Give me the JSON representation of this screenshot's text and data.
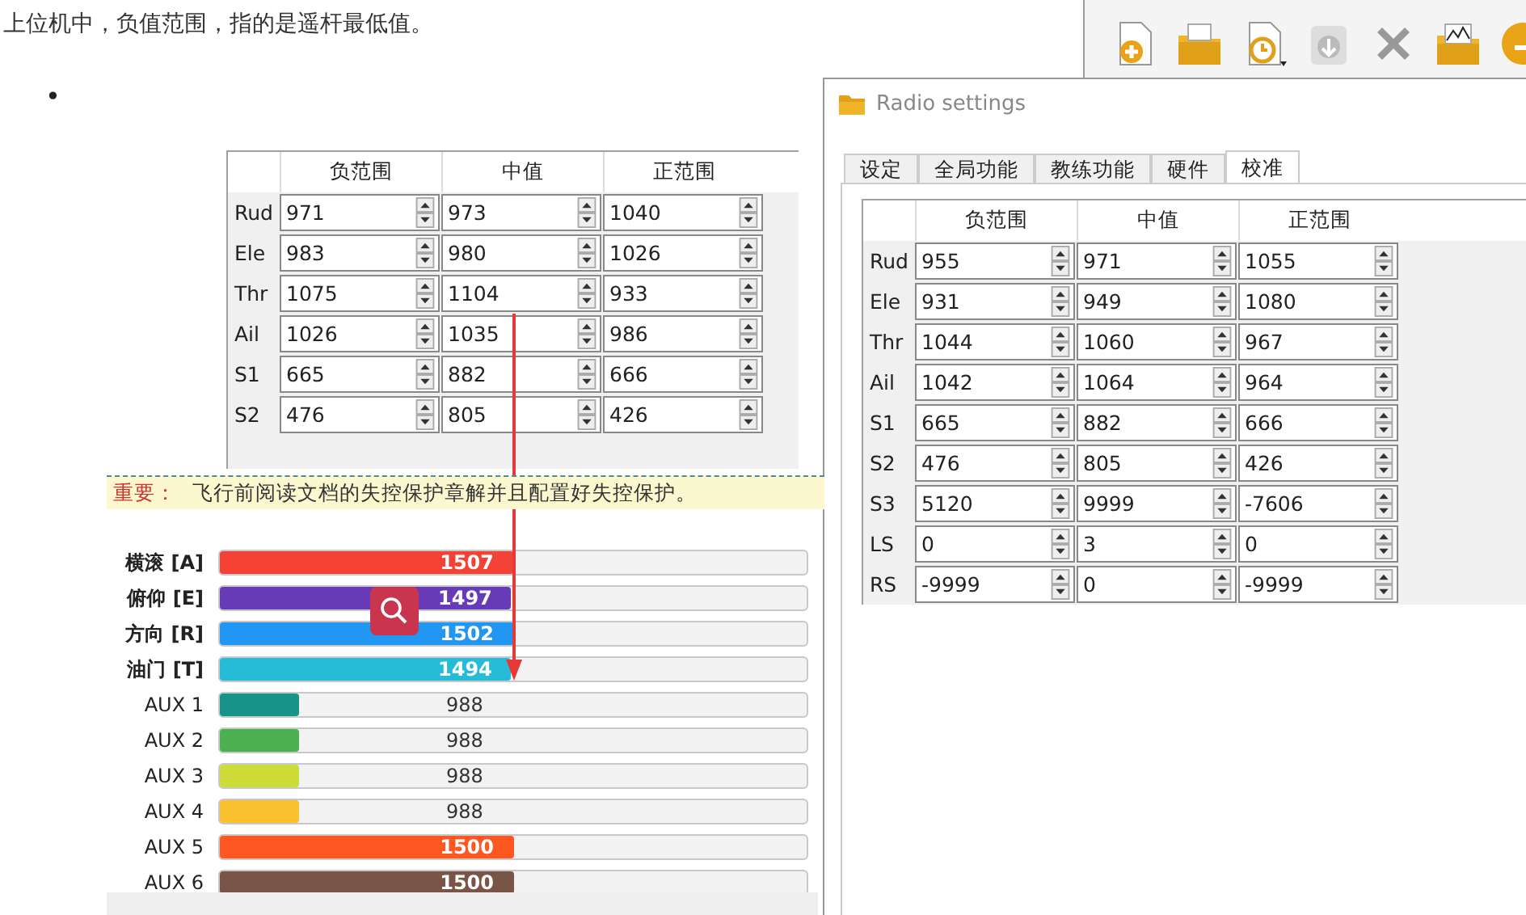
{
  "article": {
    "text": "上位机中，负值范围，指的是遥杆最低值。",
    "bullet": "•",
    "table": {
      "columns": [
        "负范围",
        "中值",
        "正范围"
      ],
      "rows": [
        {
          "label": "Rud",
          "values": [
            "971",
            "973",
            "1040"
          ]
        },
        {
          "label": "Ele",
          "values": [
            "983",
            "980",
            "1026"
          ]
        },
        {
          "label": "Thr",
          "values": [
            "1075",
            "1104",
            "933"
          ]
        },
        {
          "label": "Ail",
          "values": [
            "1026",
            "1035",
            "986"
          ]
        },
        {
          "label": "S1",
          "values": [
            "665",
            "882",
            "666"
          ]
        },
        {
          "label": "S2",
          "values": [
            "476",
            "805",
            "426"
          ]
        }
      ]
    }
  },
  "receiver": {
    "notice": {
      "label": "重要：",
      "text": "飞行前阅读文档的失控保护章解并且配置好失控保护。"
    },
    "channels": [
      {
        "label": "横滚 [A]",
        "value": "1507",
        "level": 0.5,
        "color": "#f44336"
      },
      {
        "label": "俯仰 [E]",
        "value": "1497",
        "level": 0.497,
        "color": "#673ab7"
      },
      {
        "label": "方向 [R]",
        "value": "1502",
        "level": 0.5,
        "color": "#2196f3"
      },
      {
        "label": "油门 [T]",
        "value": "1494",
        "level": 0.497,
        "color": "#26bcd7"
      },
      {
        "label": "AUX 1",
        "value": "988",
        "level": 0.135,
        "color": "#159487"
      },
      {
        "label": "AUX 2",
        "value": "988",
        "level": 0.135,
        "color": "#4caf50"
      },
      {
        "label": "AUX 3",
        "value": "988",
        "level": 0.135,
        "color": "#cddc39"
      },
      {
        "label": "AUX 4",
        "value": "988",
        "level": 0.135,
        "color": "#fbc02d"
      },
      {
        "label": "AUX 5",
        "value": "1500",
        "level": 0.5,
        "color": "#ff5722"
      },
      {
        "label": "AUX 6",
        "value": "1500",
        "level": 0.5,
        "color": "#795548"
      }
    ]
  },
  "window": {
    "title": "Radio settings",
    "tabs": [
      {
        "label": "设定",
        "selected": false
      },
      {
        "label": "全局功能",
        "selected": false
      },
      {
        "label": "教练功能",
        "selected": false
      },
      {
        "label": "硬件",
        "selected": false
      },
      {
        "label": "校准",
        "selected": true
      }
    ],
    "table": {
      "columns": [
        "负范围",
        "中值",
        "正范围"
      ],
      "rows": [
        {
          "label": "Rud",
          "values": [
            "955",
            "971",
            "1055"
          ]
        },
        {
          "label": "Ele",
          "values": [
            "931",
            "949",
            "1080"
          ]
        },
        {
          "label": "Thr",
          "values": [
            "1044",
            "1060",
            "967"
          ]
        },
        {
          "label": "Ail",
          "values": [
            "1042",
            "1064",
            "964"
          ]
        },
        {
          "label": "S1",
          "values": [
            "665",
            "882",
            "666"
          ]
        },
        {
          "label": "S2",
          "values": [
            "476",
            "805",
            "426"
          ]
        },
        {
          "label": "S3",
          "values": [
            "5120",
            "9999",
            "-7606"
          ]
        },
        {
          "label": "LS",
          "values": [
            "0",
            "3",
            "0"
          ]
        },
        {
          "label": "RS",
          "values": [
            "-9999",
            "0",
            "-9999"
          ]
        }
      ]
    }
  }
}
